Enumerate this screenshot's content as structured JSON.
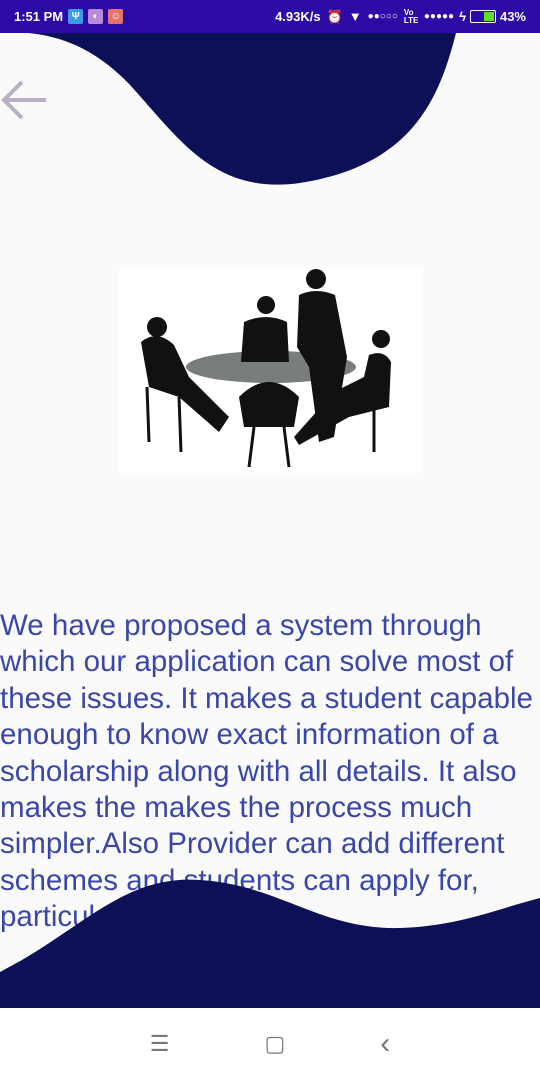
{
  "status_bar": {
    "time": "1:51 PM",
    "net_speed": "4.93K/s",
    "battery": "43%",
    "lte": "Vo LTE"
  },
  "colors": {
    "status_bg": "#2b0aa6",
    "wave": "#0d1057",
    "text": "#3a47a8"
  },
  "hero_image": "meeting-silhouette",
  "body_text": "We have proposed a system through which our application can solve most of these issues. It makes a student capable enough to know exact information of a scholarship along with all details. It also makes the makes the process much simpler.Also Provider can add different schemes and students can apply for, particular",
  "nav": {
    "menu": "☰",
    "home": "▢",
    "back": "‹"
  }
}
